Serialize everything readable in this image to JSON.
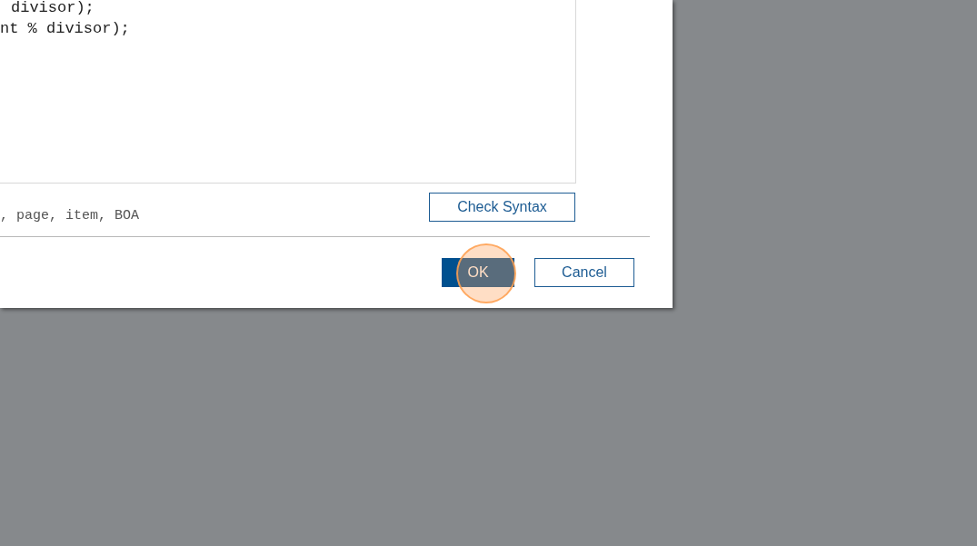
{
  "code_editor": {
    "lines": [
      {
        "text": "divisor);",
        "indent": true
      },
      {
        "text": "nt % divisor);",
        "indent": false
      }
    ]
  },
  "hint": ", page, item, BOA",
  "check_button": "Check Syntax",
  "buttons": [
    {
      "label": "OK",
      "kind": "primary"
    },
    {
      "label": "Cancel",
      "kind": "secondary"
    }
  ],
  "click_indicator": {
    "on": true
  }
}
